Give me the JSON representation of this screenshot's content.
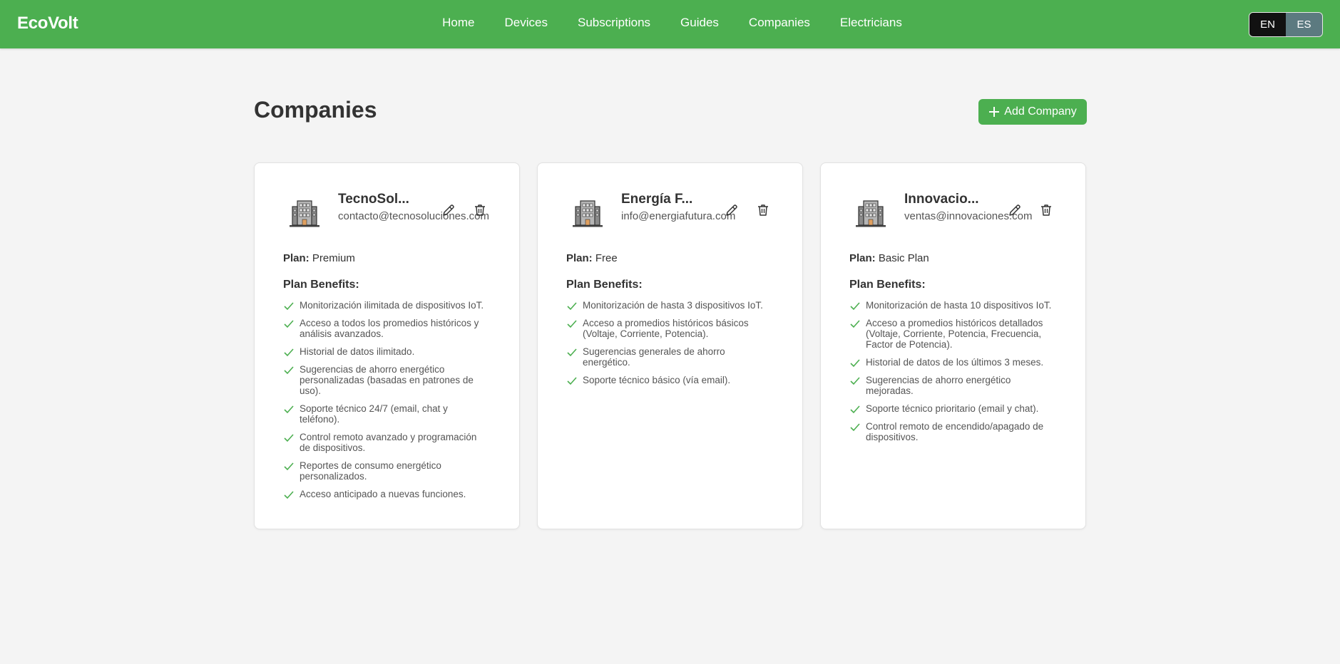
{
  "header": {
    "logo": "EcoVolt",
    "nav": [
      "Home",
      "Devices",
      "Subscriptions",
      "Guides",
      "Companies",
      "Electricians"
    ],
    "lang": {
      "en": "EN",
      "es": "ES"
    },
    "brand_color": "#4caf50"
  },
  "page": {
    "title": "Companies",
    "add_label": "Add Company"
  },
  "labels": {
    "plan": "Plan:",
    "benefits": "Plan Benefits:"
  },
  "companies": [
    {
      "name": "TecnoSol...",
      "email": "contacto@tecnosoluciones.com",
      "plan": "Premium",
      "benefits": [
        "Monitorización ilimitada de dispositivos IoT.",
        "Acceso a todos los promedios históricos y análisis avanzados.",
        "Historial de datos ilimitado.",
        "Sugerencias de ahorro energético personalizadas (basadas en patrones de uso).",
        "Soporte técnico 24/7 (email, chat y teléfono).",
        "Control remoto avanzado y programación de dispositivos.",
        "Reportes de consumo energético personalizados.",
        "Acceso anticipado a nuevas funciones."
      ]
    },
    {
      "name": "Energía F...",
      "email": "info@energiafutura.com",
      "plan": "Free",
      "benefits": [
        "Monitorización de hasta 3 dispositivos IoT.",
        "Acceso a promedios históricos básicos (Voltaje, Corriente, Potencia).",
        "Sugerencias generales de ahorro energético.",
        "Soporte técnico básico (vía email)."
      ]
    },
    {
      "name": "Innovacio...",
      "email": "ventas@innovaciones.com",
      "plan": "Basic Plan",
      "benefits": [
        "Monitorización de hasta 10 dispositivos IoT.",
        "Acceso a promedios históricos detallados (Voltaje, Corriente, Potencia, Frecuencia, Factor de Potencia).",
        "Historial de datos de los últimos 3 meses.",
        "Sugerencias de ahorro energético mejoradas.",
        "Soporte técnico prioritario (email y chat).",
        "Control remoto de encendido/apagado de dispositivos."
      ]
    }
  ]
}
